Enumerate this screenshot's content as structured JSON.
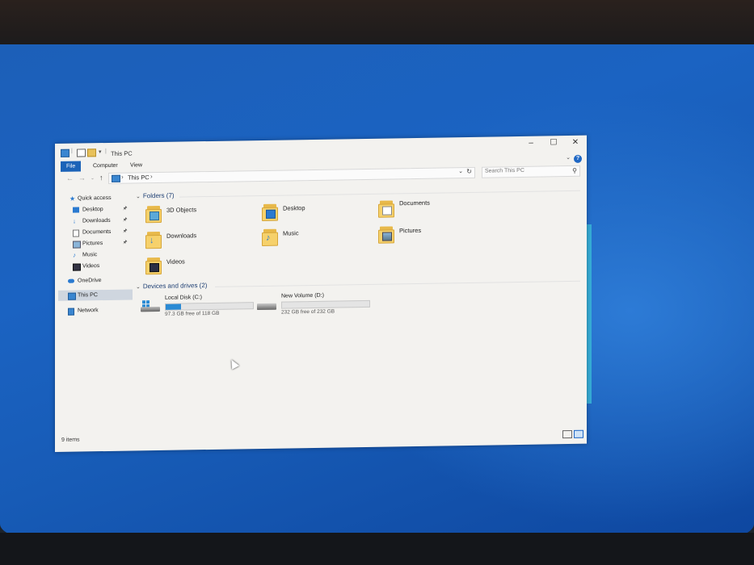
{
  "window": {
    "title": "This PC",
    "ribbon_tabs": [
      "File",
      "Computer",
      "View"
    ],
    "help_label": "?"
  },
  "address": {
    "path": "This PC",
    "search_placeholder": "Search This PC"
  },
  "nav": {
    "quick_access": "Quick access",
    "items": [
      {
        "label": "Desktop",
        "pinned": true
      },
      {
        "label": "Downloads",
        "pinned": true
      },
      {
        "label": "Documents",
        "pinned": true
      },
      {
        "label": "Pictures",
        "pinned": true
      },
      {
        "label": "Music",
        "pinned": false
      },
      {
        "label": "Videos",
        "pinned": false
      }
    ],
    "onedrive": "OneDrive",
    "this_pc": "This PC",
    "network": "Network"
  },
  "content": {
    "folders_header": "Folders (7)",
    "folders": [
      {
        "name": "3D Objects",
        "icon": "3d-objects-icon"
      },
      {
        "name": "Desktop",
        "icon": "desktop-folder-icon"
      },
      {
        "name": "Documents",
        "icon": "documents-folder-icon"
      },
      {
        "name": "Downloads",
        "icon": "downloads-folder-icon"
      },
      {
        "name": "Music",
        "icon": "music-folder-icon"
      },
      {
        "name": "Pictures",
        "icon": "pictures-folder-icon"
      },
      {
        "name": "Videos",
        "icon": "videos-folder-icon"
      }
    ],
    "drives_header": "Devices and drives (2)",
    "drives": [
      {
        "name": "Local Disk (C:)",
        "free_text": "97.3 GB free of 118 GB",
        "used_fraction": 0.18,
        "bar_color": "#2a8ad4"
      },
      {
        "name": "New Volume (D:)",
        "free_text": "232 GB free of 232 GB",
        "used_fraction": 0.0,
        "bar_color": "#2a8ad4"
      }
    ]
  },
  "status": {
    "item_count": "9 items"
  },
  "colors": {
    "accent": "#1c63b8",
    "folder": "#f6d16b",
    "desktop": "#1b63c2"
  }
}
